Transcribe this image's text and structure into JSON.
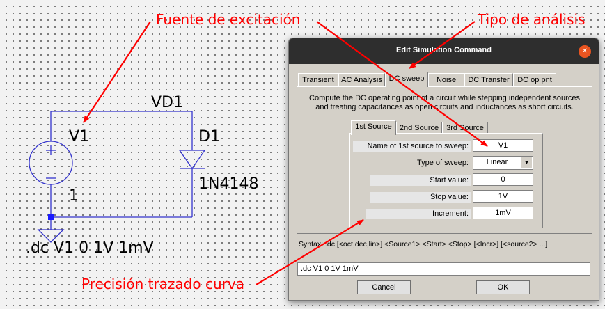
{
  "schematic": {
    "net_label": "VD1",
    "source_ref": "V1",
    "source_value": "1",
    "diode_ref": "D1",
    "diode_model": "1N4148",
    "directive": ".dc V1 0 1V 1mV"
  },
  "annotations": {
    "excitation": "Fuente de excitación",
    "analysis_type": "Tipo de análisis",
    "precision": "Precisión trazado curva"
  },
  "dialog": {
    "title": "Edit Simulation Command",
    "tabs": [
      "Transient",
      "AC Analysis",
      "DC sweep",
      "Noise",
      "DC Transfer",
      "DC op pnt"
    ],
    "active_tab": "DC sweep",
    "description_line1": "Compute the DC operating point of a circuit while stepping independent sources",
    "description_line2": "and treating capacitances as open circuits and inductances as short circuits.",
    "source_tabs": [
      "1st Source",
      "2nd Source",
      "3rd Source"
    ],
    "fields": {
      "source_name_label": "Name of 1st source to sweep:",
      "source_name_value": "V1",
      "sweep_type_label": "Type of sweep:",
      "sweep_type_value": "Linear",
      "start_label": "Start value:",
      "start_value": "0",
      "stop_label": "Stop value:",
      "stop_value": "1V",
      "increment_label": "Increment:",
      "increment_value": "1mV"
    },
    "syntax": "Syntax: .dc [<oct,dec,lin>] <Source1> <Start> <Stop> [<Incr>] [<source2> ...]",
    "command": ".dc V1 0 1V 1mV",
    "cancel_label": "Cancel",
    "ok_label": "OK"
  },
  "colors": {
    "wire": "#3333cc",
    "annotation": "#ff0000",
    "titlebar": "#2e2e2e",
    "close": "#e95420"
  }
}
